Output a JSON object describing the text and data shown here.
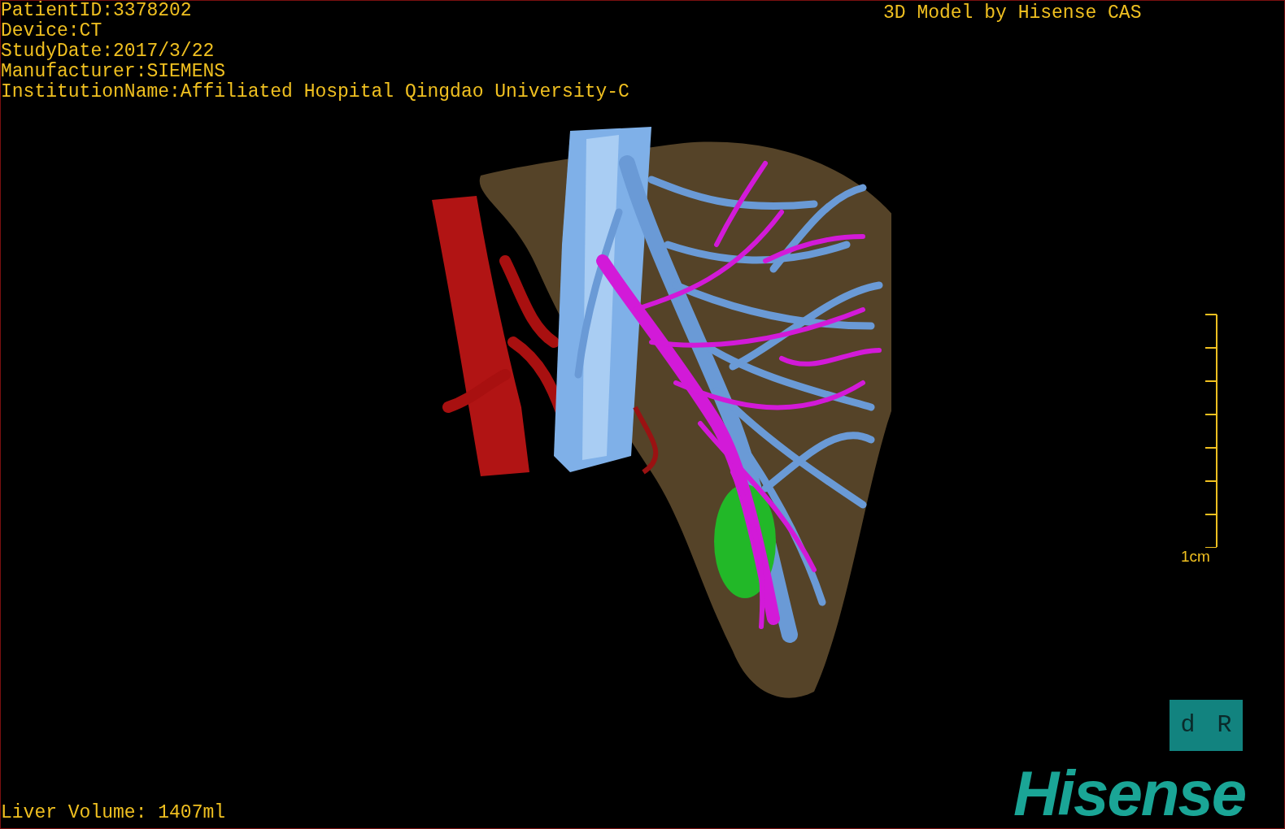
{
  "patient_info": [
    "PatientID:3378202",
    "Device:CT",
    "StudyDate:2017/3/22",
    "Manufacturer:SIEMENS",
    "InstitutionName:Affiliated Hospital Qingdao University-C"
  ],
  "title": "3D Model by Hisense CAS",
  "scale_bar": {
    "label": "1cm"
  },
  "orientation_cube": {
    "faces": [
      "d",
      "R"
    ]
  },
  "liver_volume": "Liver Volume: 1407ml",
  "logo": "Hisense"
}
